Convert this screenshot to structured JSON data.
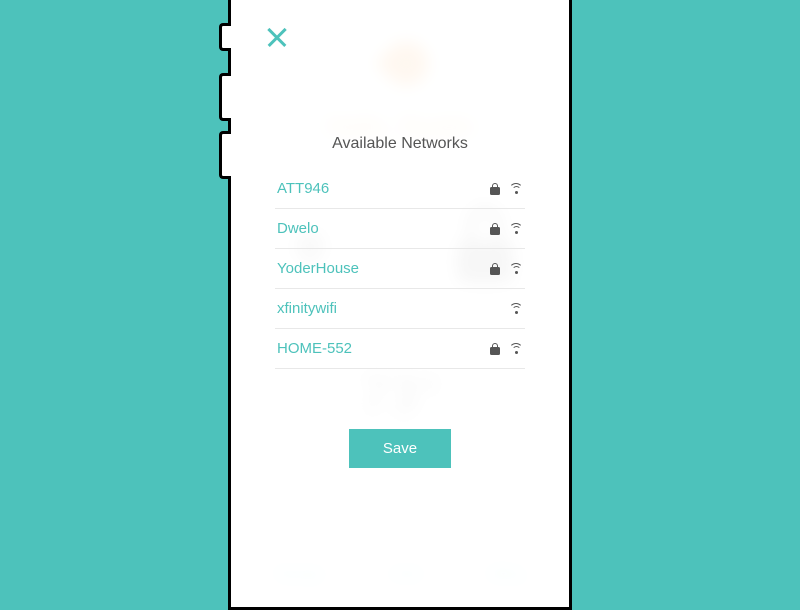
{
  "background": {
    "greeting": "Hello, Dustin",
    "temp": "73°",
    "temp_label": "Thermostat",
    "tabs": [
      "Manage",
      "Order",
      "Billing"
    ]
  },
  "modal": {
    "title": "Available Networks",
    "save_label": "Save"
  },
  "networks": [
    {
      "name": "ATT946",
      "locked": true
    },
    {
      "name": "Dwelo",
      "locked": true
    },
    {
      "name": "YoderHouse",
      "locked": true
    },
    {
      "name": "xfinitywifi",
      "locked": false
    },
    {
      "name": "HOME-552",
      "locked": true
    }
  ]
}
